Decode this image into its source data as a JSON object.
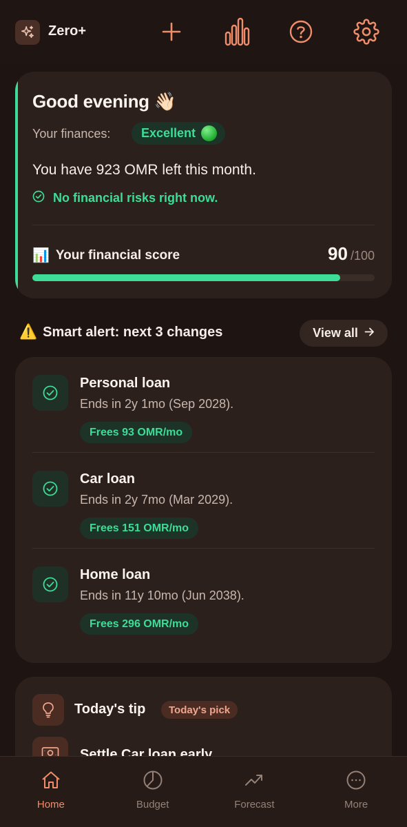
{
  "app": {
    "title": "Zero+"
  },
  "colors": {
    "accent": "#f08e6c",
    "positive": "#3ddc97",
    "background": "#1e1512",
    "card": "#2b201c"
  },
  "header": {
    "icons": [
      "sparkles-icon",
      "add-icon",
      "bar-chart-icon",
      "help-icon",
      "settings-icon"
    ]
  },
  "hero": {
    "greeting": "Good evening 👋🏻",
    "status_label": "Your finances:",
    "status_value": "Excellent",
    "left_message": "You have 923 OMR left this month.",
    "risk_message": "No financial risks right now.",
    "score_label": "Your financial score",
    "score_emoji": "📊",
    "score_value": "90",
    "score_max": "/100",
    "score_fraction": 0.9
  },
  "alerts": {
    "icon": "⚠️",
    "title": "Smart alert: next 3 changes",
    "view_all_label": "View all",
    "items": [
      {
        "name": "Personal loan",
        "subtitle": "Ends in 2y 1mo (Sep 2028).",
        "frees": "Frees 93 OMR/mo"
      },
      {
        "name": "Car loan",
        "subtitle": "Ends in 2y 7mo (Mar 2029).",
        "frees": "Frees 151 OMR/mo"
      },
      {
        "name": "Home loan",
        "subtitle": "Ends in 11y 10mo (Jun 2038).",
        "frees": "Frees 296 OMR/mo"
      }
    ]
  },
  "tip": {
    "title": "Today's tip",
    "badge": "Today's pick",
    "item_title": "Settle Car loan early"
  },
  "nav": {
    "items": [
      {
        "label": "Home",
        "icon": "home-icon",
        "active": true
      },
      {
        "label": "Budget",
        "icon": "pie-chart-icon",
        "active": false
      },
      {
        "label": "Forecast",
        "icon": "trend-up-icon",
        "active": false
      },
      {
        "label": "More",
        "icon": "more-icon",
        "active": false
      }
    ]
  }
}
